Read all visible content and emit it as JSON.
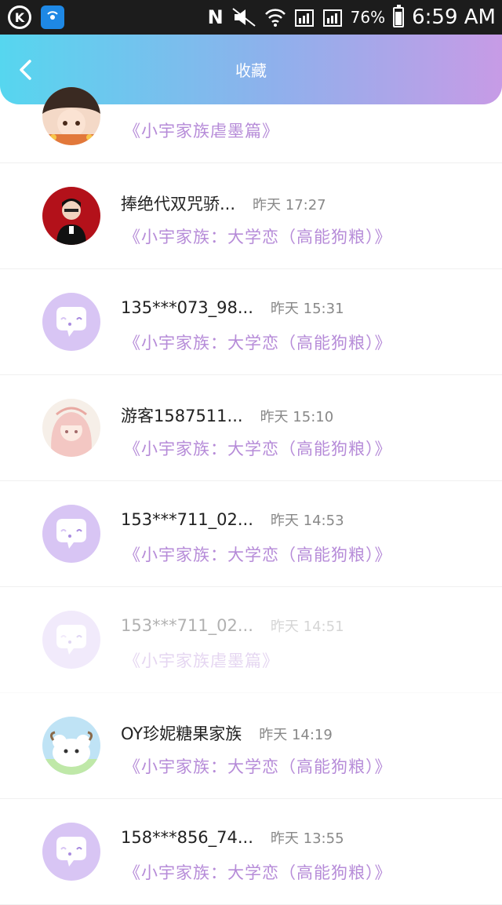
{
  "status_bar": {
    "k_badge": "K",
    "n_badge": "N",
    "battery_pct": "76%",
    "battery_level": 0.76,
    "time": "6:59 AM"
  },
  "header": {
    "title": "收藏"
  },
  "items": [
    {
      "name": "",
      "time": "",
      "title": "《小宇家族虐墨篇》",
      "avatar": "anime-girl-avatar"
    },
    {
      "name": "捧绝代双咒骄...",
      "time": "昨天 17:27",
      "title": "《小宇家族：大学恋（高能狗粮）》",
      "avatar": "character-red-avatar"
    },
    {
      "name": "135***073_98...",
      "time": "昨天 15:31",
      "title": "《小宇家族：大学恋（高能狗粮）》",
      "avatar": "default-chat-avatar"
    },
    {
      "name": "游客1587511...",
      "time": "昨天 15:10",
      "title": "《小宇家族：大学恋（高能狗粮）》",
      "avatar": "anime-sketch-avatar"
    },
    {
      "name": "153***711_02...",
      "time": "昨天 14:53",
      "title": "《小宇家族：大学恋（高能狗粮）》",
      "avatar": "default-chat-avatar"
    },
    {
      "name": "153***711_02...",
      "time": "昨天 14:51",
      "title": "《小宇家族虐墨篇》",
      "avatar": "default-chat-avatar"
    },
    {
      "name": "OY珍妮糖果家族",
      "time": "昨天 14:19",
      "title": "《小宇家族：大学恋（高能狗粮）》",
      "avatar": "sheep-avatar"
    },
    {
      "name": "158***856_74...",
      "time": "昨天 13:55",
      "title": "《小宇家族：大学恋（高能狗粮）》",
      "avatar": "default-chat-avatar"
    }
  ]
}
